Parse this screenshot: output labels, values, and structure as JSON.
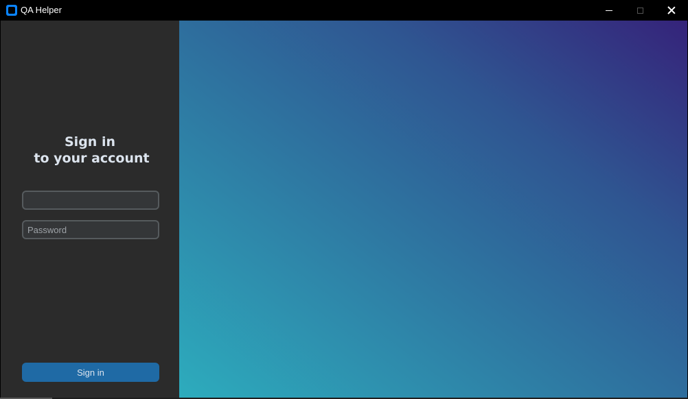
{
  "window": {
    "title": "QA Helper",
    "icon": "app-icon",
    "controls": [
      "minimize-icon",
      "maximize-icon",
      "close-icon"
    ]
  },
  "login": {
    "heading_line1": "Sign in",
    "heading_line2": "to your account",
    "username_placeholder": "",
    "username_value": "",
    "password_placeholder": "Password",
    "password_value": "",
    "signin_label": "Sign in"
  },
  "colors": {
    "left_panel": "#2b2b2b",
    "button": "#1f6aa5",
    "gradient_start": "#2dacbd",
    "gradient_end": "#35237a"
  }
}
